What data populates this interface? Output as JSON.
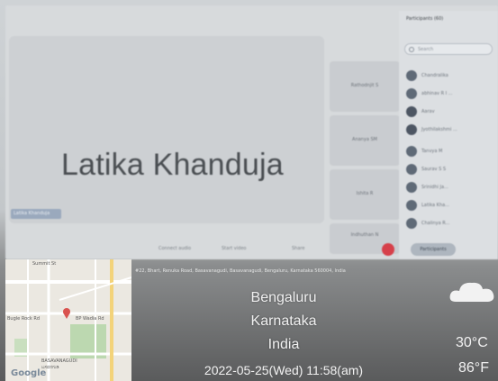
{
  "meeting": {
    "main_speaker": "Latika Khanduja",
    "main_tag": "Latika Khanduja",
    "side_tiles": [
      "Rathodnjit S",
      "Ananya SM",
      "Ishita R",
      "Indhuthan N"
    ],
    "participants_title": "Participants (60)",
    "search_placeholder": "Search",
    "participants": [
      "Chandralika",
      "abhinav R I ...",
      "Aarav",
      "Jyothilakshmi ...",
      "Tanvya M",
      "Saurav S S",
      "Srinidhi Ja...",
      "Latika Kha...",
      "Chalinya R..."
    ],
    "toolbar": {
      "audio": "Connect audio",
      "video": "Start video",
      "share": "Share",
      "participants": "Participants"
    }
  },
  "geotag": {
    "address": "#22, Bhart, Renuka Road, Basavanagudi, Basavanagudi, Bengaluru, Karnataka 560004, India",
    "city": "Bengaluru",
    "state": "Karnataka",
    "country": "India",
    "datetime": "2022-05-25(Wed)  11:58(am)",
    "temp_c": "30°C",
    "temp_f": "86°F",
    "weather_icon": "cloud-icon",
    "map": {
      "labels": [
        "Summit St",
        "Bugle Rock Rd",
        "BP Wadia Rd",
        "BASAVANAGUDI",
        "ಬಸವನಗುಡಿ"
      ],
      "logo": "Google",
      "pin_color": "#d9534f"
    }
  }
}
